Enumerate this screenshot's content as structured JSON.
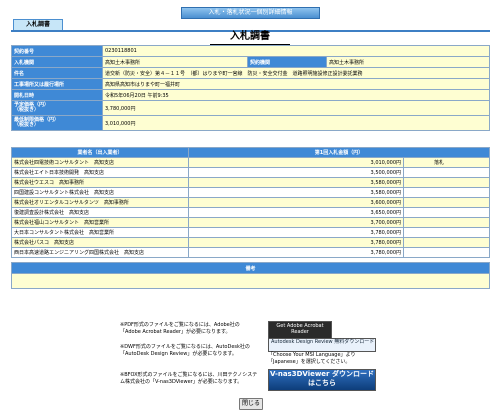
{
  "header": {
    "bar_title": "入札・落札状況一個別詳細情報",
    "tab_label": "入札調書",
    "page_title": "入札調書"
  },
  "info": [
    {
      "label": "契約番号",
      "value": "0230118801"
    },
    {
      "label": "入札機関",
      "value": "高知土木事務所",
      "label2": "契約機関",
      "value2": "高知土木事務所"
    },
    {
      "label": "件名",
      "value": "道交新（防災・安全）第４－１１号　（都）はりまや町一宮線　防災・安全交付金　道路照明施設修正設計委託業務"
    },
    {
      "label": "工事場所又は履行場所",
      "value": "高知県高知市はりまや町一福井町"
    },
    {
      "label": "開札日時",
      "value": "令和5年06月20日 午前9:35"
    },
    {
      "label": "予定価格（円）\n（税抜き）",
      "value": "3,780,000円"
    },
    {
      "label": "最低制限価格（円）\n（税抜き）",
      "value": "3,010,000円"
    }
  ],
  "results": {
    "headers": [
      "業者名（出入業者）",
      "第1回入札金額（円）"
    ],
    "rows": [
      {
        "name": "株式会社四電技術コンサルタント　高知支店",
        "amount": "3,010,000円",
        "note": "落札"
      },
      {
        "name": "株式会社エイト日本技術開発　高知支店",
        "amount": "3,500,000円",
        "note": ""
      },
      {
        "name": "株式会社ウエスコ　高知事務所",
        "amount": "3,580,000円",
        "note": ""
      },
      {
        "name": "四国建設コンサルタント株式会社　高知支店",
        "amount": "3,580,000円",
        "note": ""
      },
      {
        "name": "株式会社オリエンタルコンサルタンツ　高知事務所",
        "amount": "3,600,000円",
        "note": ""
      },
      {
        "name": "復建調査設計株式会社　高知支店",
        "amount": "3,650,000円",
        "note": ""
      },
      {
        "name": "株式会社福山コンサルタント　高知営業所",
        "amount": "3,700,000円",
        "note": ""
      },
      {
        "name": "大日本コンサルタント株式会社　高知営業所",
        "amount": "3,780,000円",
        "note": ""
      },
      {
        "name": "株式会社パスコ　高知支店",
        "amount": "3,780,000円",
        "note": ""
      },
      {
        "name": "西日本高速道路エンジニアリング四国株式会社　高知支店",
        "amount": "3,780,000円",
        "note": ""
      }
    ]
  },
  "biko": {
    "header": "備考"
  },
  "notes": [
    {
      "text": "※PDF形式のファイルをご覧になるには、Adobe社の「Adobe Acrobat Reader」が必要になります。",
      "badge": "Get Adobe Acrobat Reader"
    },
    {
      "text": "※DWF形式のファイルをご覧になるには、AutoDesk社の「AutoDesk Design Review」が必要になります。",
      "badge": "Autodesk Design Review 無料ダウンロード",
      "side": "「Choose Your MSI Language」より「Japanese」を選択してください。"
    },
    {
      "text": "※BFOX形式のファイルをご覧になるには、川田テクノシステム株式会社の「V-nas3DViewer」が必要になります。",
      "badge": "V-nas3DViewer ダウンロードはこちら"
    }
  ],
  "close_label": "閉じる"
}
